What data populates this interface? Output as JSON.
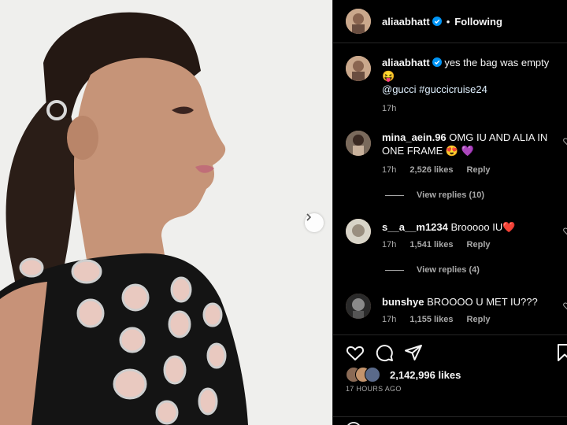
{
  "post": {
    "author": "aliaabhatt",
    "follow_status": "Following",
    "separator": "•"
  },
  "caption": {
    "author": "aliaabhatt",
    "text": "yes the bag was empty",
    "emoji": "😝",
    "tags": "@gucci #guccicruise24",
    "time": "17h"
  },
  "comments": [
    {
      "user": "mina_aein.96",
      "text": "OMG IU AND ALIA IN ONE FRAME 😍 💜",
      "time": "17h",
      "likes": "2,526 likes",
      "reply": "Reply",
      "view_replies": "View replies (10)"
    },
    {
      "user": "s__a__m1234",
      "text": "Brooooo IU❤️",
      "time": "17h",
      "likes": "1,541 likes",
      "reply": "Reply",
      "view_replies": "View replies (4)"
    },
    {
      "user": "bunshye",
      "text": "BROOOO U MET IU???",
      "time": "17h",
      "likes": "1,155 likes",
      "reply": "Reply"
    }
  ],
  "stats": {
    "likes": "2,142,996 likes",
    "posted": "17 HOURS AGO"
  },
  "colors": {
    "panel_bg": "#000000",
    "verified": "#0095f6",
    "muted_text": "#a8a8a8"
  },
  "icons": [
    "verified-icon",
    "chevron-right-icon",
    "heart-icon",
    "comment-icon",
    "share-icon",
    "bookmark-icon",
    "heart-small-icon"
  ]
}
